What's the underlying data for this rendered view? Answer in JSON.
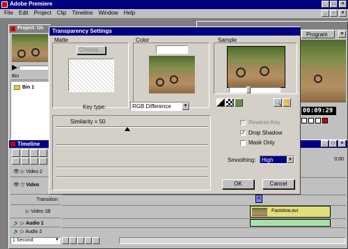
{
  "app": {
    "title": "Adobe Premiere",
    "menu": [
      "File",
      "Edit",
      "Project",
      "Clip",
      "Timeline",
      "Window",
      "Help"
    ]
  },
  "project_window": {
    "title": "Project: Un",
    "bin_header": "Bin",
    "bin_item": "Bin 1"
  },
  "monitor_window": {
    "program_tab": "Program",
    "timecode": "00:09:29"
  },
  "dialog": {
    "title": "Transparency Settings",
    "matte_label": "Matte",
    "choose_button": "Choose...",
    "color_label": "Color",
    "sample_label": "Sample",
    "key_type_label": "Key type:",
    "key_type_value": "RGB Difference",
    "similarity_label": "Similarity = 50",
    "reverse_key_label": "Reverse Key",
    "drop_shadow_label": "Drop Shadow",
    "mask_only_label": "Mask Only",
    "smoothing_label": "Smoothing:",
    "smoothing_value": "High",
    "ok_button": "OK",
    "cancel_button": "Cancel",
    "reverse_key_checked": false,
    "drop_shadow_checked": true,
    "mask_only_checked": false,
    "reverse_key_enabled": false,
    "similarity_value": 50
  },
  "timeline": {
    "title": "Timeline",
    "tracks": [
      "Video 2",
      "Video",
      "Transition",
      "Video 1B",
      "Audio 1",
      "Audio 2"
    ],
    "clip_name": "Fastslow.avi",
    "transition_marker": "A",
    "ruler_label": "0;00",
    "zoom_value": "1 Second"
  },
  "colors": {
    "titlebar_active": "#000080",
    "titlebar_inactive": "#808080",
    "clip_fill": "#e0e07a",
    "dialog_bg": "#d4d0c8"
  }
}
